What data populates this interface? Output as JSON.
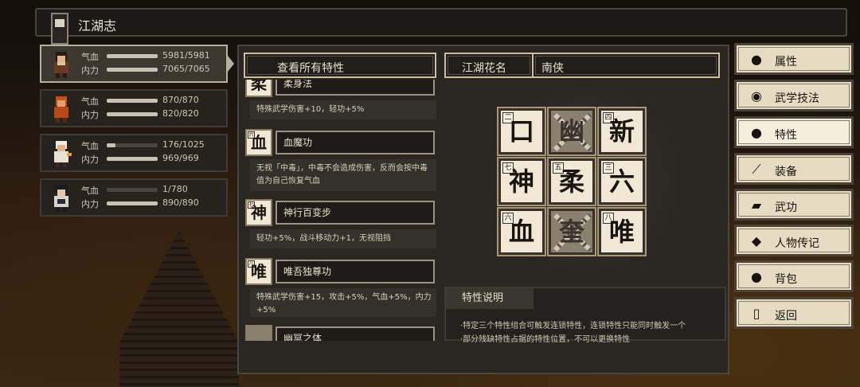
{
  "title": "江湖志",
  "characters": [
    {
      "hp_label": "气血",
      "hp": "5981/5981",
      "hp_frac": 1.0,
      "mp_label": "内力",
      "mp": "7065/7065",
      "mp_frac": 1.0
    },
    {
      "hp_label": "气血",
      "hp": "870/870",
      "hp_frac": 1.0,
      "mp_label": "内力",
      "mp": "820/820",
      "mp_frac": 1.0
    },
    {
      "hp_label": "气血",
      "hp": "176/1025",
      "hp_frac": 0.17,
      "mp_label": "内力",
      "mp": "969/969",
      "mp_frac": 1.0
    },
    {
      "hp_label": "气血",
      "hp": "1/780",
      "hp_frac": 0.0,
      "mp_label": "内力",
      "mp": "890/890",
      "mp_frac": 1.0
    }
  ],
  "view_all_traits": "查看所有特性",
  "nickname_label": "江湖花名",
  "nickname_value": "南侠",
  "traits": [
    {
      "icon": "柔",
      "tag": "",
      "name": "柔身法",
      "desc": "特殊武学伤害+10，轻功+5%"
    },
    {
      "icon": "血",
      "tag": "六",
      "name": "血魔功",
      "desc": "无视「中毒」，中毒不会造成伤害，反而会按中毒值为自己恢复气血"
    },
    {
      "icon": "神",
      "tag": "七",
      "name": "神行百变步",
      "desc": "轻功+5%，战斗移动力+1，无视阻挡"
    },
    {
      "icon": "唯",
      "tag": "八",
      "name": "唯吾独尊功",
      "desc": "特殊武学伤害+15，攻击+5%，气血+5%，内力+5%"
    },
    {
      "icon": "",
      "tag": "",
      "name": "幽冥之体",
      "desc": ""
    }
  ],
  "board": [
    {
      "char": "口",
      "tag": "二",
      "locked": false
    },
    {
      "char": "幽",
      "tag": "",
      "locked": true
    },
    {
      "char": "新",
      "tag": "四",
      "locked": false
    },
    {
      "char": "神",
      "tag": "七",
      "locked": false
    },
    {
      "char": "柔",
      "tag": "五",
      "locked": false
    },
    {
      "char": "六",
      "tag": "三",
      "locked": false
    },
    {
      "char": "血",
      "tag": "六",
      "locked": false
    },
    {
      "char": "奎",
      "tag": "",
      "locked": true
    },
    {
      "char": "唯",
      "tag": "八",
      "locked": false
    }
  ],
  "desc_title": "特性说明",
  "desc_lines": [
    "·特定三个特性组合可触发连锁特性，连锁特性只能同时触发一个",
    "·部分残缺特性占据的特性位置，不可以更换特性"
  ],
  "menu": [
    {
      "label": "属性",
      "icon": "person-icon"
    },
    {
      "label": "武学技法",
      "icon": "martial-icon"
    },
    {
      "label": "特性",
      "icon": "trait-icon"
    },
    {
      "label": "装备",
      "icon": "sword-icon"
    },
    {
      "label": "武功",
      "icon": "book-icon"
    },
    {
      "label": "人物传记",
      "icon": "biography-icon"
    },
    {
      "label": "背包",
      "icon": "bag-icon"
    },
    {
      "label": "返回",
      "icon": "door-icon"
    }
  ]
}
